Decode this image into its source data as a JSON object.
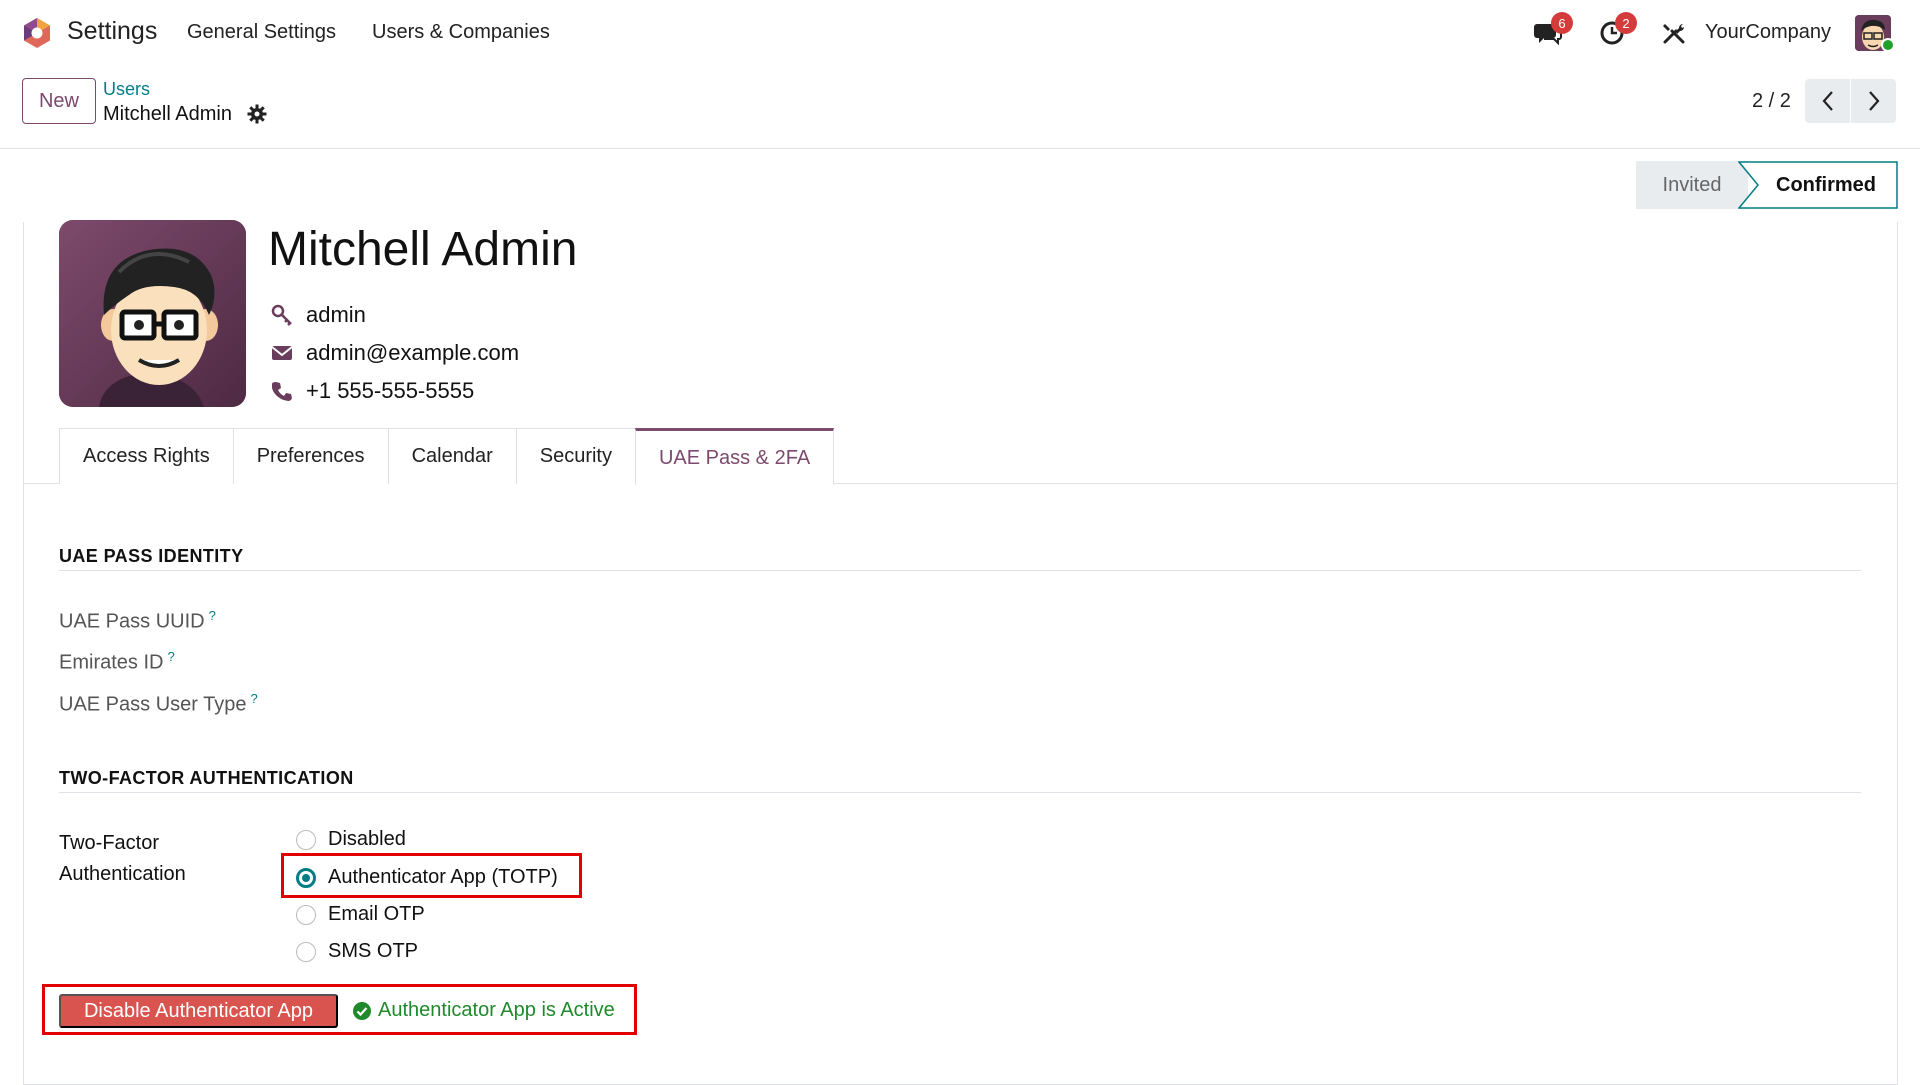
{
  "navbar": {
    "app_name": "Settings",
    "menu": [
      "General Settings",
      "Users & Companies"
    ],
    "messages_badge": "6",
    "activities_badge": "2",
    "company": "YourCompany",
    "icons": [
      "chat-icon",
      "clock-icon",
      "tools-icon"
    ]
  },
  "control_panel": {
    "new_label": "New",
    "breadcrumb_parent": "Users",
    "breadcrumb_current": "Mitchell Admin",
    "pager": "2 / 2"
  },
  "status": {
    "invited": "Invited",
    "confirmed": "Confirmed",
    "current": "Confirmed"
  },
  "user": {
    "name": "Mitchell Admin",
    "login": "admin",
    "email": "admin@example.com",
    "phone": "+1 555-555-5555"
  },
  "tabs": [
    {
      "label": "Access Rights"
    },
    {
      "label": "Preferences"
    },
    {
      "label": "Calendar"
    },
    {
      "label": "Security"
    },
    {
      "label": "UAE Pass & 2FA"
    }
  ],
  "active_tab": "UAE Pass & 2FA",
  "uae_pass": {
    "title": "UAE PASS IDENTITY",
    "fields": [
      {
        "label": "UAE Pass UUID",
        "help": "?"
      },
      {
        "label": "Emirates ID",
        "help": "?"
      },
      {
        "label": "UAE Pass User Type",
        "help": "?"
      }
    ]
  },
  "tfa": {
    "title": "TWO-FACTOR AUTHENTICATION",
    "label": "Two-Factor Authentication",
    "options": [
      {
        "label": "Disabled",
        "checked": false
      },
      {
        "label": "Authenticator App (TOTP)",
        "checked": true
      },
      {
        "label": "Email OTP",
        "checked": false
      },
      {
        "label": "SMS OTP",
        "checked": false
      }
    ],
    "disable_button": "Disable Authenticator App",
    "active_message": "Authenticator App is Active"
  },
  "colors": {
    "brand": "#7c4a6e",
    "link": "#017e84",
    "danger": "#d9534f",
    "success": "#1f8a2b",
    "highlight": "#e00000"
  }
}
